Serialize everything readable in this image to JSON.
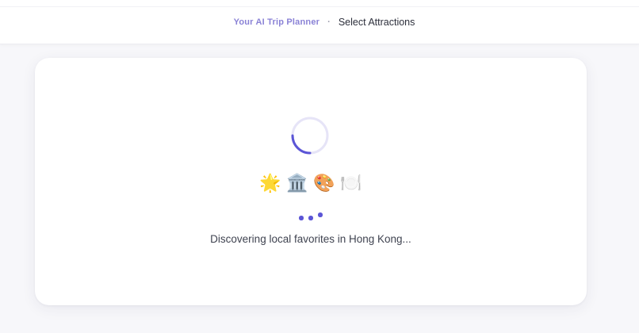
{
  "header": {
    "brand": "Your AI Trip Planner",
    "separator": "·",
    "title": "Select Attractions"
  },
  "loading": {
    "emojis": [
      {
        "icon": "star-sparkle-icon",
        "glyph": "🌟"
      },
      {
        "icon": "museum-icon",
        "glyph": "🏛️"
      },
      {
        "icon": "art-palette-icon",
        "glyph": "🎨"
      },
      {
        "icon": "dining-icon",
        "glyph": "🍽️"
      }
    ],
    "message": "Discovering local favorites in Hong Kong..."
  },
  "colors": {
    "accent": "#5b55d6",
    "brand": "#8a82d6",
    "spinner_track": "#e6e4f7",
    "text": "#3f4350",
    "background": "#f7f7fa"
  }
}
